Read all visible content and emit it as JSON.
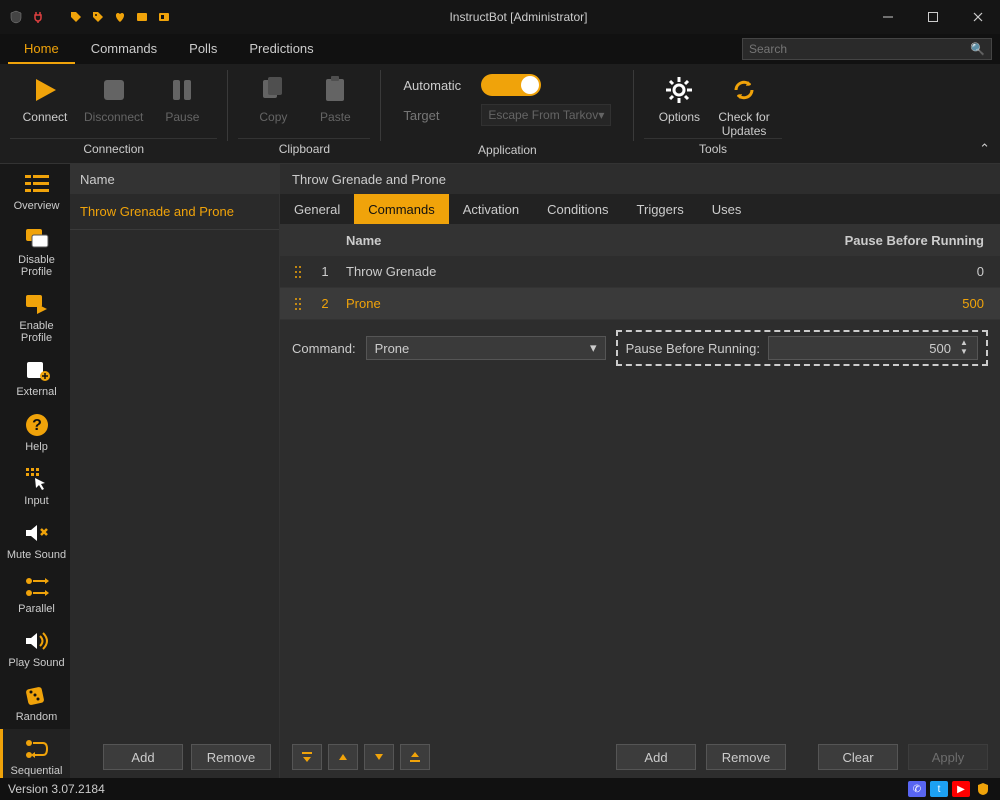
{
  "titlebar": {
    "title": "InstructBot [Administrator]"
  },
  "menu": {
    "items": [
      "Home",
      "Commands",
      "Polls",
      "Predictions"
    ],
    "active": 0,
    "search_placeholder": "Search"
  },
  "ribbon": {
    "connection": {
      "label": "Connection",
      "connect": "Connect",
      "disconnect": "Disconnect",
      "pause": "Pause"
    },
    "clipboard": {
      "label": "Clipboard",
      "copy": "Copy",
      "paste": "Paste"
    },
    "application": {
      "label": "Application",
      "automatic": "Automatic",
      "target": "Target",
      "target_value": "Escape From Tarkov"
    },
    "tools": {
      "label": "Tools",
      "options": "Options",
      "check_updates": "Check for\nUpdates"
    }
  },
  "sidebar": {
    "items": [
      {
        "label": "Overview"
      },
      {
        "label": "Disable Profile"
      },
      {
        "label": "Enable Profile"
      },
      {
        "label": "External"
      },
      {
        "label": "Help"
      },
      {
        "label": "Input"
      },
      {
        "label": "Mute Sound"
      },
      {
        "label": "Parallel"
      },
      {
        "label": "Play Sound"
      },
      {
        "label": "Random"
      },
      {
        "label": "Sequential"
      }
    ],
    "active": 10
  },
  "list": {
    "header": "Name",
    "items": [
      "Throw Grenade and Prone"
    ],
    "add": "Add",
    "remove": "Remove"
  },
  "detail": {
    "title": "Throw Grenade and Prone",
    "tabs": [
      "General",
      "Commands",
      "Activation",
      "Conditions",
      "Triggers",
      "Uses"
    ],
    "active_tab": 1,
    "columns": {
      "name": "Name",
      "pause": "Pause Before Running"
    },
    "rows": [
      {
        "idx": "1",
        "name": "Throw Grenade",
        "pause": "0"
      },
      {
        "idx": "2",
        "name": "Prone",
        "pause": "500"
      }
    ],
    "selected_row": 1,
    "edit": {
      "command_label": "Command:",
      "command_value": "Prone",
      "pause_label": "Pause Before Running:",
      "pause_value": "500"
    },
    "actions": {
      "add": "Add",
      "remove": "Remove",
      "clear": "Clear",
      "apply": "Apply"
    }
  },
  "status": {
    "version": "Version 3.07.2184"
  },
  "colors": {
    "accent": "#f0a30a"
  }
}
